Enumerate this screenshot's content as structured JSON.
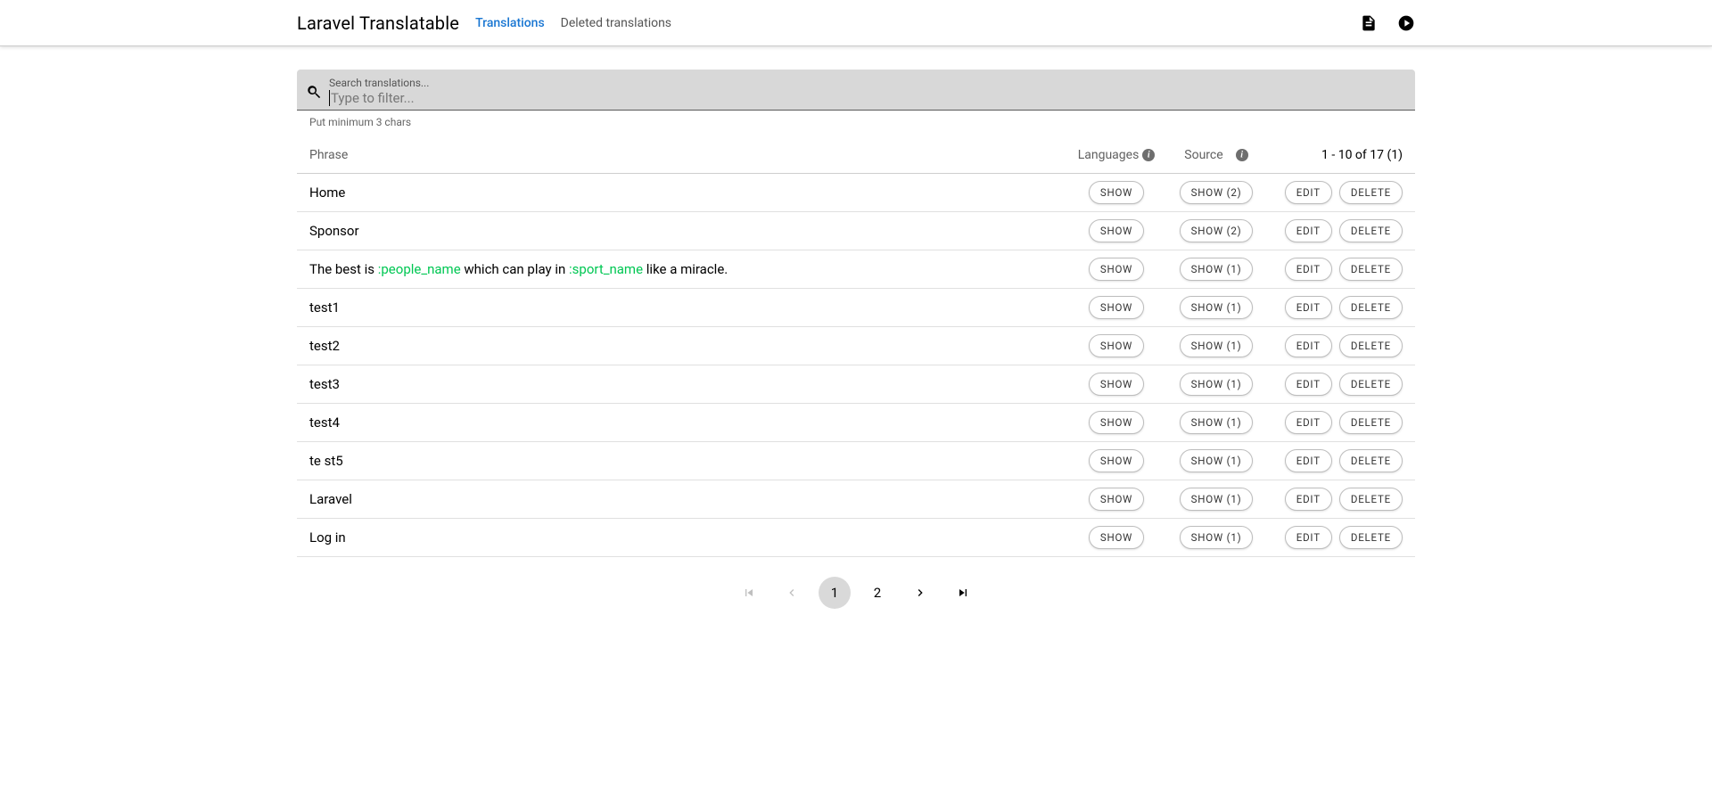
{
  "app": {
    "title": "Laravel Translatable"
  },
  "nav": {
    "translations": "Translations",
    "deleted": "Deleted translations"
  },
  "search": {
    "label": "Search translations...",
    "placeholder": "Type to filter...",
    "hint": "Put minimum 3 chars"
  },
  "table": {
    "head_phrase": "Phrase",
    "head_languages": "Languages",
    "head_source": "Source",
    "range": "1 - 10 of 17 (1)"
  },
  "labels": {
    "show": "SHOW",
    "edit": "EDIT",
    "delete": "DELETE"
  },
  "rows": [
    {
      "phrase_html": "Home",
      "src": "SHOW (2)"
    },
    {
      "phrase_html": "Sponsor",
      "src": "SHOW (2)"
    },
    {
      "phrase_html": "The best is <span class=\"placeholder-token\">:people_name</span> which can play in <span class=\"placeholder-token\">:sport_name</span> like a miracle.",
      "src": "SHOW (1)"
    },
    {
      "phrase_html": "test1",
      "src": "SHOW (1)"
    },
    {
      "phrase_html": "test2",
      "src": "SHOW (1)"
    },
    {
      "phrase_html": "test3",
      "src": "SHOW (1)"
    },
    {
      "phrase_html": "test4",
      "src": "SHOW (1)"
    },
    {
      "phrase_html": "te st5",
      "src": "SHOW (1)"
    },
    {
      "phrase_html": "Laravel",
      "src": "SHOW (1)"
    },
    {
      "phrase_html": "Log in",
      "src": "SHOW (1)"
    }
  ],
  "pager": {
    "p1": "1",
    "p2": "2"
  }
}
